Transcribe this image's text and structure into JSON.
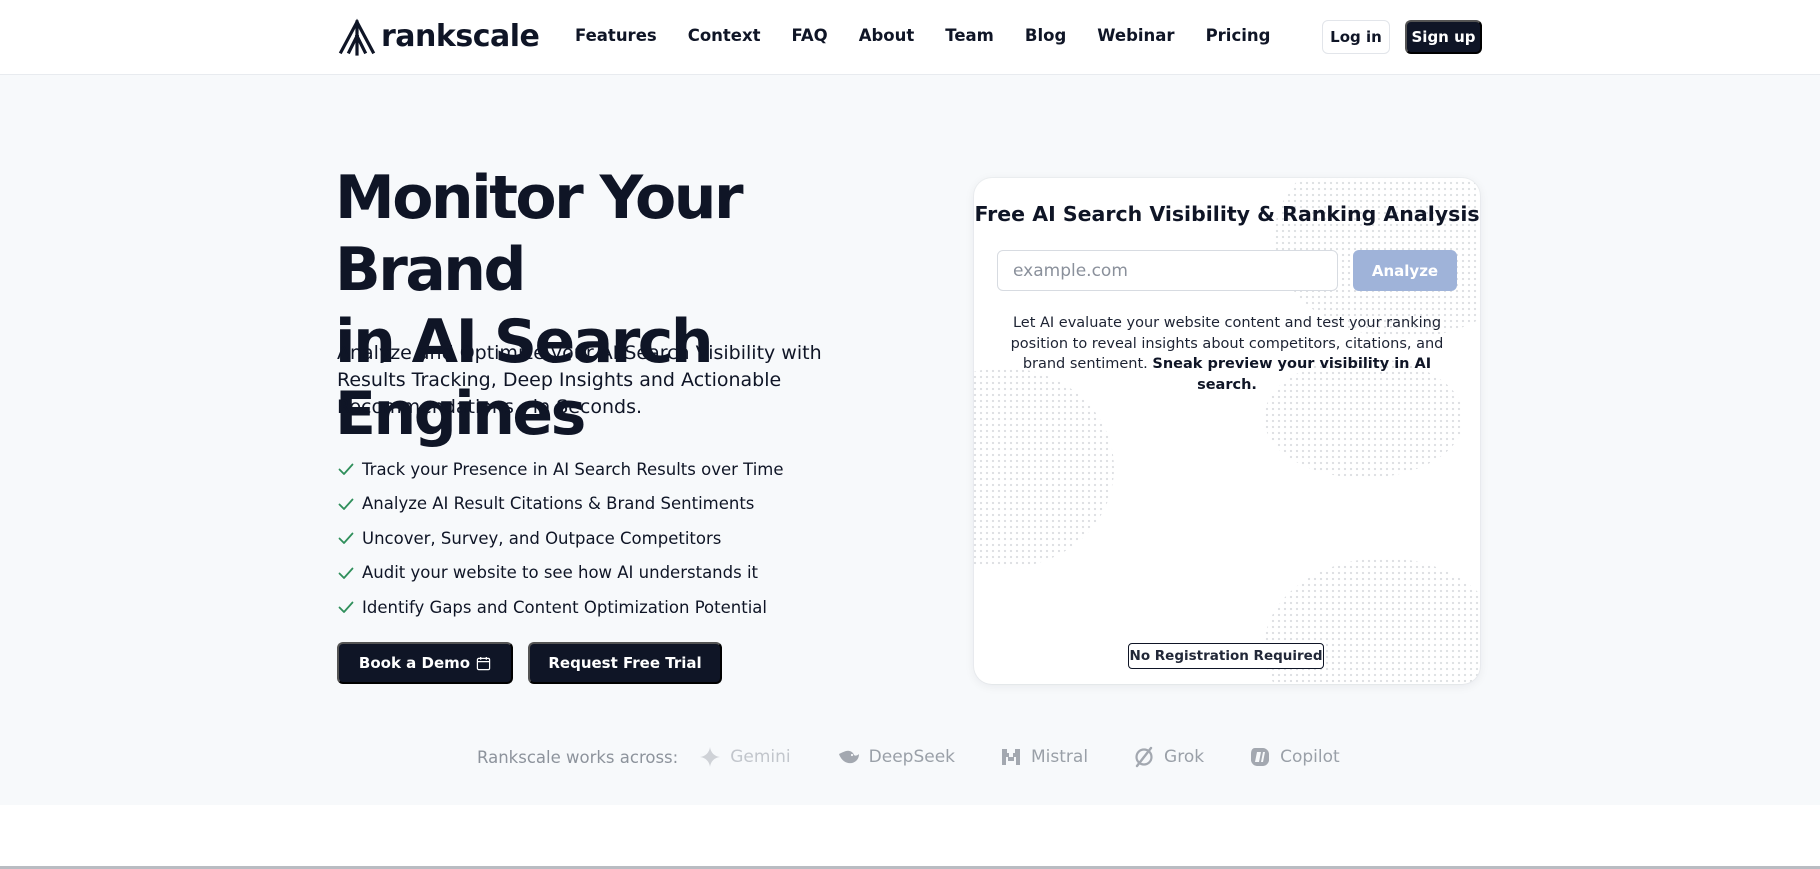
{
  "brand": {
    "name": "rankscale"
  },
  "nav": {
    "links": [
      "Features",
      "Context",
      "FAQ",
      "About",
      "Team",
      "Blog",
      "Webinar",
      "Pricing"
    ],
    "login_label": "Log in",
    "signup_label": "Sign up"
  },
  "hero": {
    "title_line1": "Monitor Your Brand",
    "title_line2": "in AI Search Engines",
    "subtitle": "Analyze and Optimize your AI Search Visibility with Results Tracking, Deep Insights and Actionable Recommendations - in Seconds.",
    "features": [
      "Track your Presence in AI Search Results over Time",
      "Analyze AI Result Citations & Brand Sentiments",
      "Uncover, Survey, and Outpace Competitors",
      "Audit your website to see how AI understands it",
      "Identify Gaps and Content Optimization Potential"
    ],
    "demo_label": "Book a Demo",
    "trial_label": "Request Free Trial"
  },
  "card": {
    "title": "Free AI Search Visibility & Ranking Analysis",
    "input_placeholder": "example.com",
    "input_value": "",
    "analyze_label": "Analyze",
    "description": "Let AI evaluate your website content and test your ranking position to reveal insights about competitors, citations, and brand sentiment.",
    "description_bold": "Sneak preview your visibility in AI search.",
    "badge": "No Registration Required"
  },
  "works_across": {
    "label": "Rankscale works across:",
    "providers": [
      {
        "name": "Gemini",
        "icon": "gemini-icon"
      },
      {
        "name": "DeepSeek",
        "icon": "deepseek-icon"
      },
      {
        "name": "Mistral",
        "icon": "mistral-icon"
      },
      {
        "name": "Grok",
        "icon": "grok-icon"
      },
      {
        "name": "Copilot",
        "icon": "copilot-icon"
      }
    ]
  },
  "colors": {
    "primary": "#0f1526",
    "analyze_button": "#9fb3d9",
    "check": "#2f8f5b",
    "background": "#f7f9fb"
  }
}
